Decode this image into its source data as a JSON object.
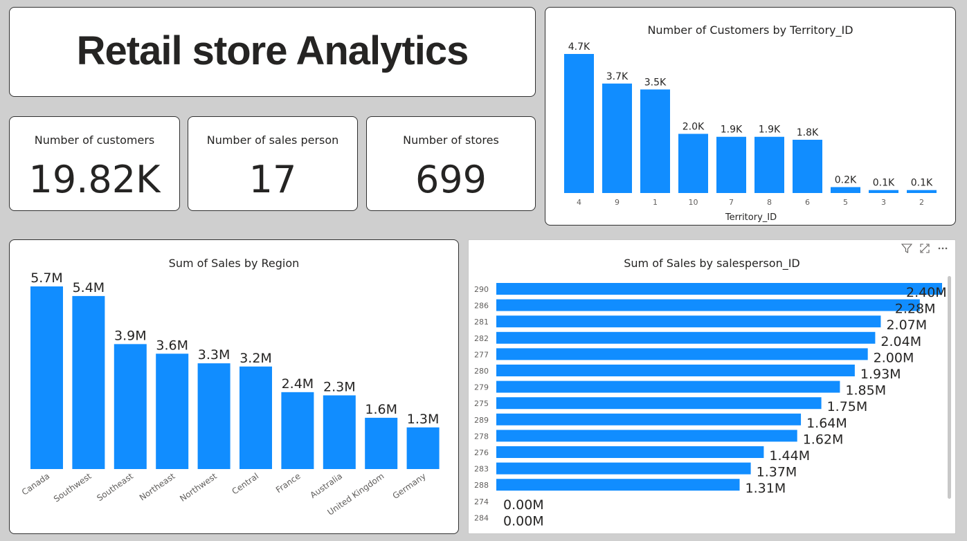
{
  "title": "Retail store Analytics",
  "kpis": {
    "customers": {
      "label": "Number of customers",
      "value": "19.82K"
    },
    "salesperson": {
      "label": "Number of sales person",
      "value": "17"
    },
    "stores": {
      "label": "Number of stores",
      "value": "699"
    }
  },
  "colors": {
    "bar": "#118DFF",
    "text": "#252423",
    "axis": "#605E5C"
  },
  "icons": [
    "filter-icon",
    "focus-mode-icon",
    "more-options-icon"
  ],
  "chart_data": [
    {
      "id": "territory",
      "type": "bar",
      "title": "Number of Customers by Territory_ID",
      "xlabel": "Territory_ID",
      "ylabel": "",
      "categories": [
        "4",
        "9",
        "1",
        "10",
        "7",
        "8",
        "6",
        "5",
        "3",
        "2"
      ],
      "values": [
        4.7,
        3.7,
        3.5,
        2.0,
        1.9,
        1.9,
        1.8,
        0.2,
        0.1,
        0.1
      ],
      "labels": [
        "4.7K",
        "3.7K",
        "3.5K",
        "2.0K",
        "1.9K",
        "1.9K",
        "1.8K",
        "0.2K",
        "0.1K",
        "0.1K"
      ],
      "ylim": [
        0,
        4.7
      ]
    },
    {
      "id": "region",
      "type": "bar",
      "title": "Sum of Sales by Region",
      "xlabel": "",
      "ylabel": "",
      "categories": [
        "Canada",
        "Southwest",
        "Southeast",
        "Northeast",
        "Northwest",
        "Central",
        "France",
        "Australia",
        "United Kingdom",
        "Germany"
      ],
      "values": [
        5.7,
        5.4,
        3.9,
        3.6,
        3.3,
        3.2,
        2.4,
        2.3,
        1.6,
        1.3
      ],
      "labels": [
        "5.7M",
        "5.4M",
        "3.9M",
        "3.6M",
        "3.3M",
        "3.2M",
        "2.4M",
        "2.3M",
        "1.6M",
        "1.3M"
      ],
      "ylim": [
        0,
        5.7
      ]
    },
    {
      "id": "salesperson",
      "type": "bar",
      "orientation": "horizontal",
      "title": "Sum of Sales by salesperson_ID",
      "xlabel": "",
      "ylabel": "",
      "categories": [
        "290",
        "286",
        "281",
        "282",
        "277",
        "280",
        "279",
        "275",
        "289",
        "278",
        "276",
        "283",
        "288",
        "274",
        "284"
      ],
      "values": [
        2.4,
        2.28,
        2.07,
        2.04,
        2.0,
        1.93,
        1.85,
        1.75,
        1.64,
        1.62,
        1.44,
        1.37,
        1.31,
        0.0,
        0.0
      ],
      "labels": [
        "2.40M",
        "2.28M",
        "2.07M",
        "2.04M",
        "2.00M",
        "1.93M",
        "1.85M",
        "1.75M",
        "1.64M",
        "1.62M",
        "1.44M",
        "1.37M",
        "1.31M",
        "0.00M",
        "0.00M"
      ],
      "xlim": [
        0,
        2.4
      ]
    }
  ]
}
